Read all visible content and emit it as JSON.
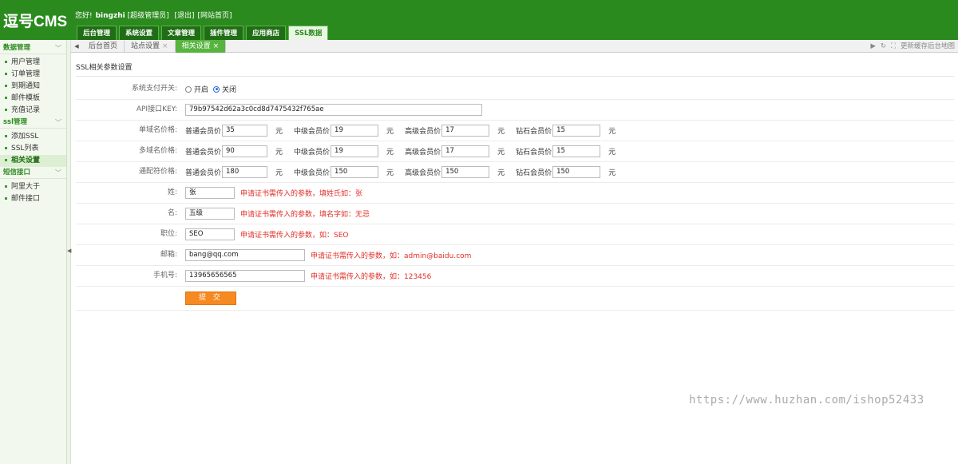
{
  "header": {
    "logo": "逗号CMS",
    "greeting": "您好!",
    "username": "bingzhi",
    "role": "[超级管理员]",
    "logout": "[退出]",
    "site_home": "[网站首页]",
    "tabs": [
      "后台管理",
      "系统设置",
      "文章管理",
      "插件管理",
      "应用商店",
      "SSL数据"
    ],
    "active_tab": "SSL数据"
  },
  "sidebar": {
    "groups": [
      {
        "title": "数据管理",
        "items": [
          "用户管理",
          "订单管理",
          "到期通知",
          "邮件模板",
          "充值记录"
        ]
      },
      {
        "title": "ssl管理",
        "items": [
          "添加SSL",
          "SSL列表",
          "相关设置"
        ]
      },
      {
        "title": "短信接口",
        "items": [
          "阿里大于",
          "邮件接口"
        ]
      }
    ],
    "active_item": "相关设置"
  },
  "tabbar": {
    "tabs": [
      "后台首页",
      "站点设置",
      "相关设置"
    ],
    "close": "×",
    "right_text": "更新缓存后台地图"
  },
  "form": {
    "title": "SSL相关参数设置",
    "pay_switch": {
      "label": "系统支付开关:",
      "options": [
        "开启",
        "关闭"
      ],
      "selected": "关闭"
    },
    "api_key": {
      "label": "API接口KEY:",
      "value": "79b97542d62a3c0cd8d7475432f765ae"
    },
    "prices": [
      {
        "label": "单域名价格:",
        "values": [
          "35",
          "19",
          "17",
          "15"
        ]
      },
      {
        "label": "多域名价格:",
        "values": [
          "90",
          "19",
          "17",
          "15"
        ]
      },
      {
        "label": "通配符价格:",
        "values": [
          "180",
          "150",
          "150",
          "150"
        ]
      }
    ],
    "levels": [
      "普通会员价",
      "中级会员价",
      "高级会员价",
      "钻石会员价"
    ],
    "unit": "元",
    "fields": [
      {
        "label": "姓:",
        "value": "张",
        "hint": "申请证书需传入的参数，填姓氏如：张"
      },
      {
        "label": "名:",
        "value": "五级",
        "hint": "申请证书需传入的参数，填名字如：无忌"
      },
      {
        "label": "职位:",
        "value": "SEO",
        "hint": "申请证书需传入的参数，如：SEO"
      },
      {
        "label": "邮箱:",
        "value": "bang@qq.com",
        "hint": "申请证书需传入的参数，如：admin@baidu.com"
      },
      {
        "label": "手机号:",
        "value": "13965656565",
        "hint": "申请证书需传入的参数，如：123456"
      }
    ],
    "submit": "提 交"
  },
  "watermark": "https://www.huzhan.com/ishop52433",
  "colors": {
    "header_green": "#2b8a1e",
    "hint_red": "#e0302a",
    "submit_orange": "#f6891f"
  }
}
